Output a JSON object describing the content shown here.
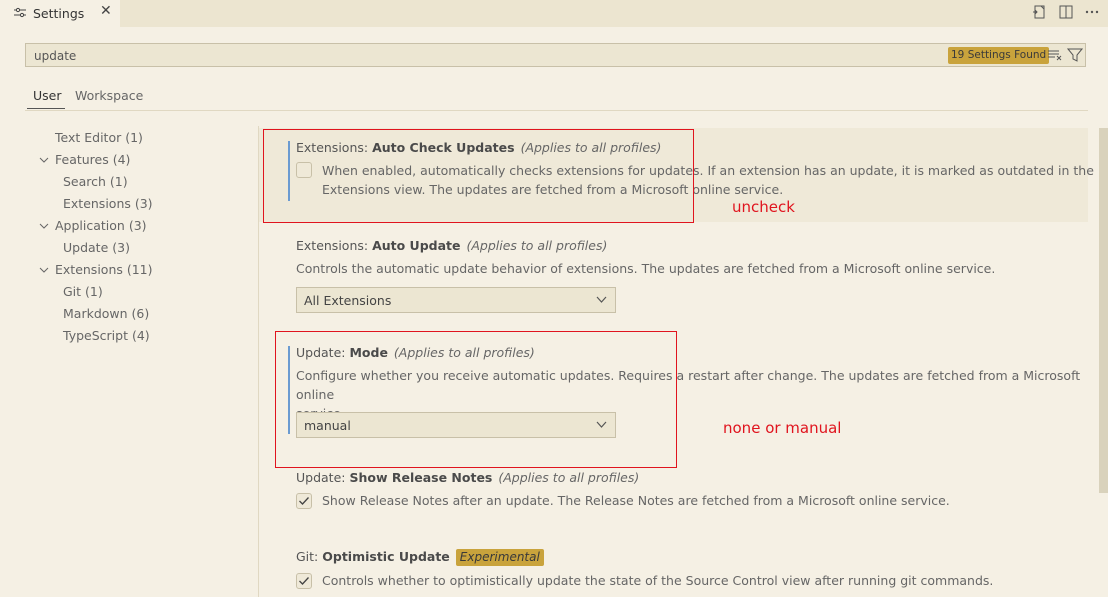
{
  "tab": {
    "label": "Settings",
    "close": "✕"
  },
  "search": {
    "value": "update",
    "found_badge": "19 Settings Found"
  },
  "scopes": {
    "user": "User",
    "workspace": "Workspace"
  },
  "toc": [
    {
      "label": "Text Editor (1)"
    },
    {
      "label": "Features (4)"
    },
    {
      "label": "Search (1)"
    },
    {
      "label": "Extensions (3)"
    },
    {
      "label": "Application (3)"
    },
    {
      "label": "Update (3)"
    },
    {
      "label": "Extensions (11)"
    },
    {
      "label": "Git (1)"
    },
    {
      "label": "Markdown (6)"
    },
    {
      "label": "TypeScript (4)"
    }
  ],
  "settings": {
    "auto_check": {
      "category": "Extensions: ",
      "name": "Auto Check Updates",
      "applies": "(Applies to all profiles)",
      "desc1": "When enabled, automatically checks extensions for updates. If an extension has an update, it is marked as outdated in the",
      "desc2": "Extensions view. The updates are fetched from a Microsoft online service."
    },
    "auto_update": {
      "category": "Extensions: ",
      "name": "Auto Update",
      "applies": "(Applies to all profiles)",
      "desc": "Controls the automatic update behavior of extensions. The updates are fetched from a Microsoft online service.",
      "value": "All Extensions"
    },
    "update_mode": {
      "category": "Update: ",
      "name": "Mode",
      "applies": "(Applies to all profiles)",
      "desc1": "Configure whether you receive automatic updates. Requires a restart after change. The updates are fetched from a Microsoft online",
      "desc2": "service.",
      "value": "manual"
    },
    "release_notes": {
      "category": "Update: ",
      "name": "Show Release Notes",
      "applies": "(Applies to all profiles)",
      "desc": "Show Release Notes after an update. The Release Notes are fetched from a Microsoft online service."
    },
    "git_optimistic": {
      "category": "Git: ",
      "name": "Optimistic Update",
      "badge": "Experimental",
      "desc": "Controls whether to optimistically update the state of the Source Control view after running git commands."
    }
  },
  "annotations": {
    "uncheck": "uncheck",
    "none_or_manual": "none or manual"
  },
  "colors": {
    "accent_badge": "#c9a33c",
    "annotation_red": "#e0141e",
    "focus_bar": "#6b9bd1"
  }
}
